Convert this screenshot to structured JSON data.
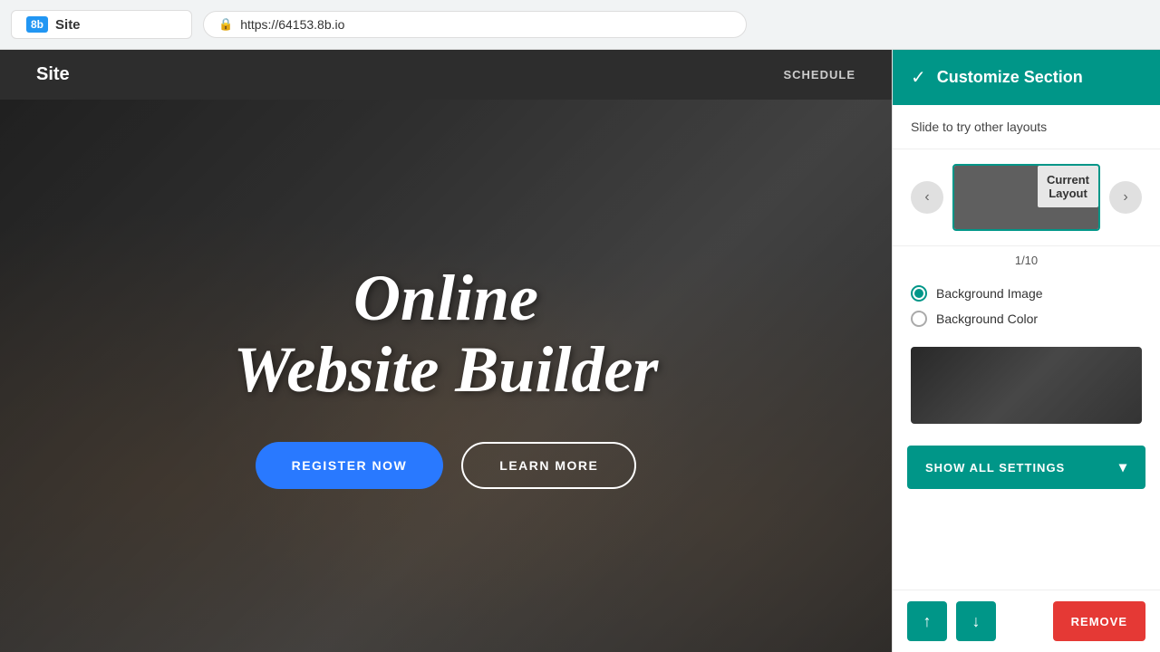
{
  "browser": {
    "logo_badge": "8b",
    "site_label": "Site",
    "address": "https://64153.8b.io"
  },
  "site_nav": {
    "logo": "Site",
    "links": [
      "SCHEDULE"
    ]
  },
  "hero": {
    "title_line1": "Online",
    "title_line2": "Website Builder",
    "btn_register": "REGISTER NOW",
    "btn_learn": "LEARN MORE"
  },
  "panel": {
    "header": {
      "check": "✓",
      "title": "Customize Section"
    },
    "subtitle": "Slide to try other layouts",
    "carousel": {
      "prev_label": "‹",
      "next_label": "›",
      "current_layout": "Current\nLayout"
    },
    "counter": "1/10",
    "bg_options": [
      {
        "id": "bg-image",
        "label": "Background Image",
        "selected": true
      },
      {
        "id": "bg-color",
        "label": "Background Color",
        "selected": false
      }
    ],
    "show_all_btn": "SHOW ALL SETTINGS",
    "footer": {
      "move_up": "↑",
      "move_down": "↓",
      "remove": "REMOVE"
    }
  }
}
